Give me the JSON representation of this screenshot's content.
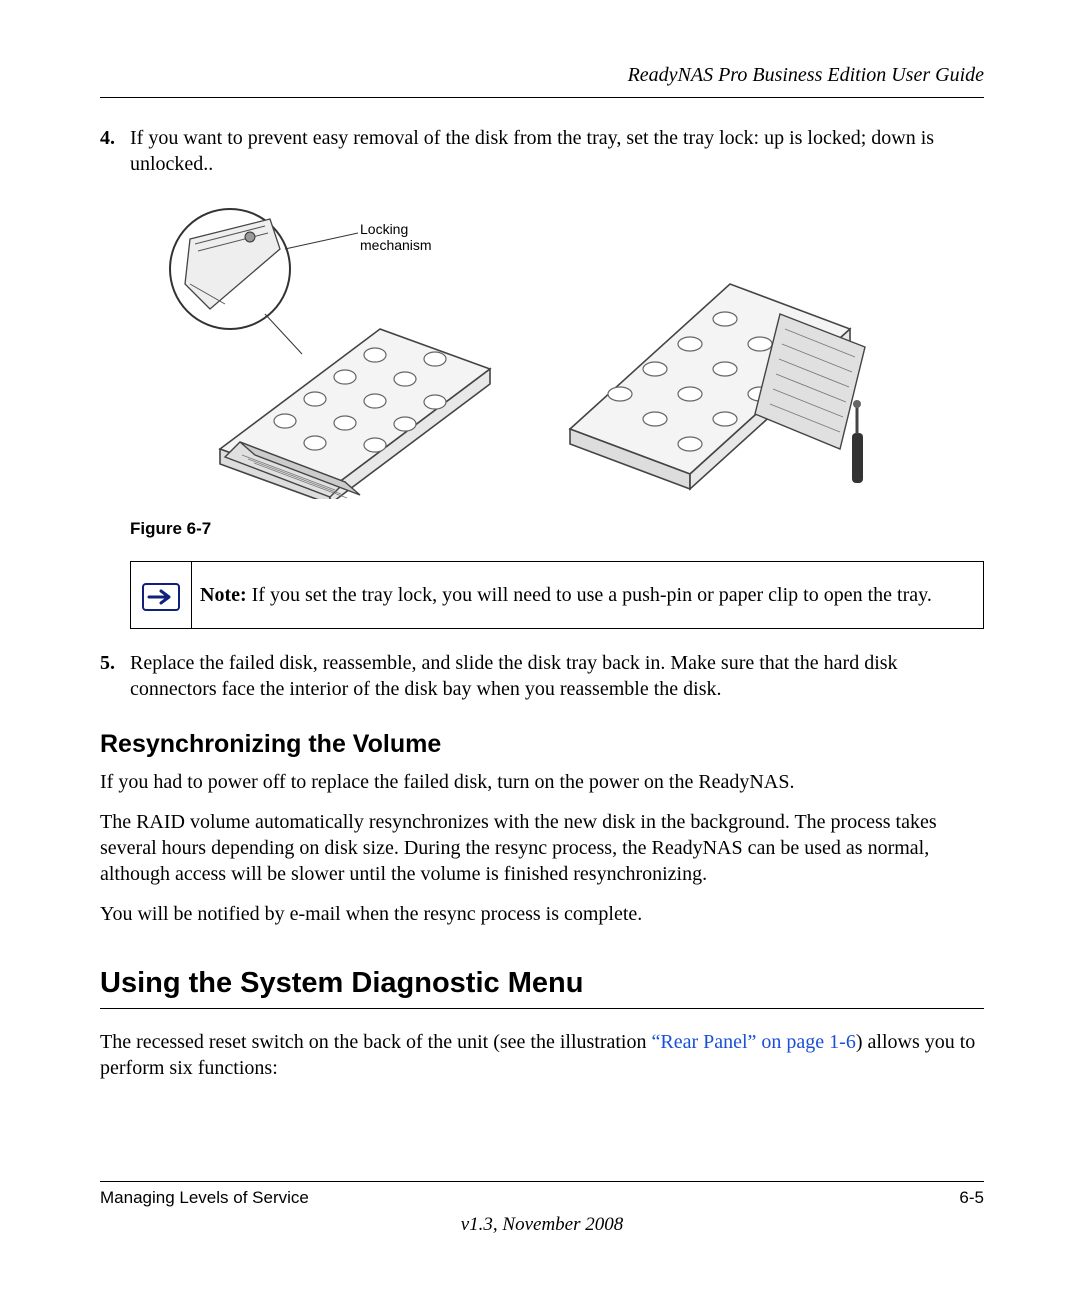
{
  "header": {
    "doc_title": "ReadyNAS Pro Business Edition User Guide"
  },
  "steps": {
    "s4_num": "4.",
    "s4_text": "If you want to prevent easy removal of the disk from the tray, set the tray lock: up is locked; down is unlocked..",
    "s5_num": "5.",
    "s5_text": "Replace the failed disk, reassemble, and slide the disk tray back in. Make sure that the hard disk connectors face the interior of the disk bay when you reassemble the disk."
  },
  "figure": {
    "caption": "Figure 6-7",
    "callout_line1": "Locking",
    "callout_line2": "mechanism"
  },
  "note": {
    "label": "Note:",
    "text": " If you set the tray lock, you will need to use a push-pin or paper clip to open the tray."
  },
  "resync": {
    "heading": "Resynchronizing the Volume",
    "p1": "If you had to power off to replace the failed disk, turn on the power on the ReadyNAS.",
    "p2": "The RAID volume automatically resynchronizes with the new disk in the background. The process takes several hours depending on disk size. During the resync process, the ReadyNAS can be used as normal, although access will be slower until the volume is finished resynchronizing.",
    "p3": "You will be notified by e-mail when the resync process is complete."
  },
  "diag": {
    "heading": "Using the System Diagnostic Menu",
    "p1_pre": "The recessed reset switch on the back of the unit (see the illustration ",
    "p1_link": "“Rear Panel” on page 1-6",
    "p1_post": ") allows you to perform six functions:"
  },
  "footer": {
    "left": "Managing Levels of Service",
    "right": "6-5",
    "version": "v1.3, November 2008"
  }
}
